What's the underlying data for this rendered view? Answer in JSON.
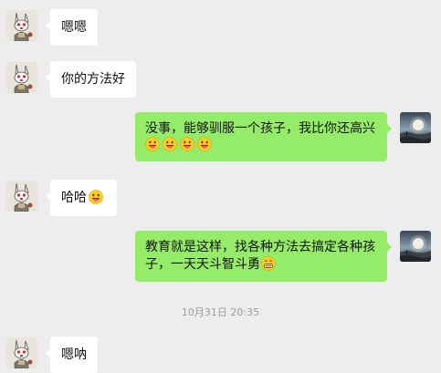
{
  "messages": [
    {
      "side": "left",
      "text": "嗯嗯"
    },
    {
      "side": "left",
      "text": "你的方法好"
    },
    {
      "side": "right",
      "text": "没事，能够驯服一个孩子，我比你还高兴",
      "emojis": [
        "grin-tongue",
        "grin-tongue",
        "grin-tongue",
        "grin-tongue"
      ]
    },
    {
      "side": "left",
      "text": "哈哈",
      "emojis": [
        "grin-tongue"
      ]
    },
    {
      "side": "right",
      "text": "教育就是这样，找各种方法去搞定各种孩子，一天天斗智斗勇",
      "emojis": [
        "grimace"
      ]
    },
    {
      "side": "left",
      "text": "嗯呐"
    }
  ],
  "timestamp": "10月31日 20:35",
  "colors": {
    "background": "#ededed",
    "incoming_bubble": "#ffffff",
    "outgoing_bubble": "#95ec69",
    "timestamp_text": "#9c9c9c"
  },
  "icons": {
    "contact_avatar": "cartoon-rabbit-avatar",
    "self_avatar": "moonlit-landscape-avatar"
  }
}
